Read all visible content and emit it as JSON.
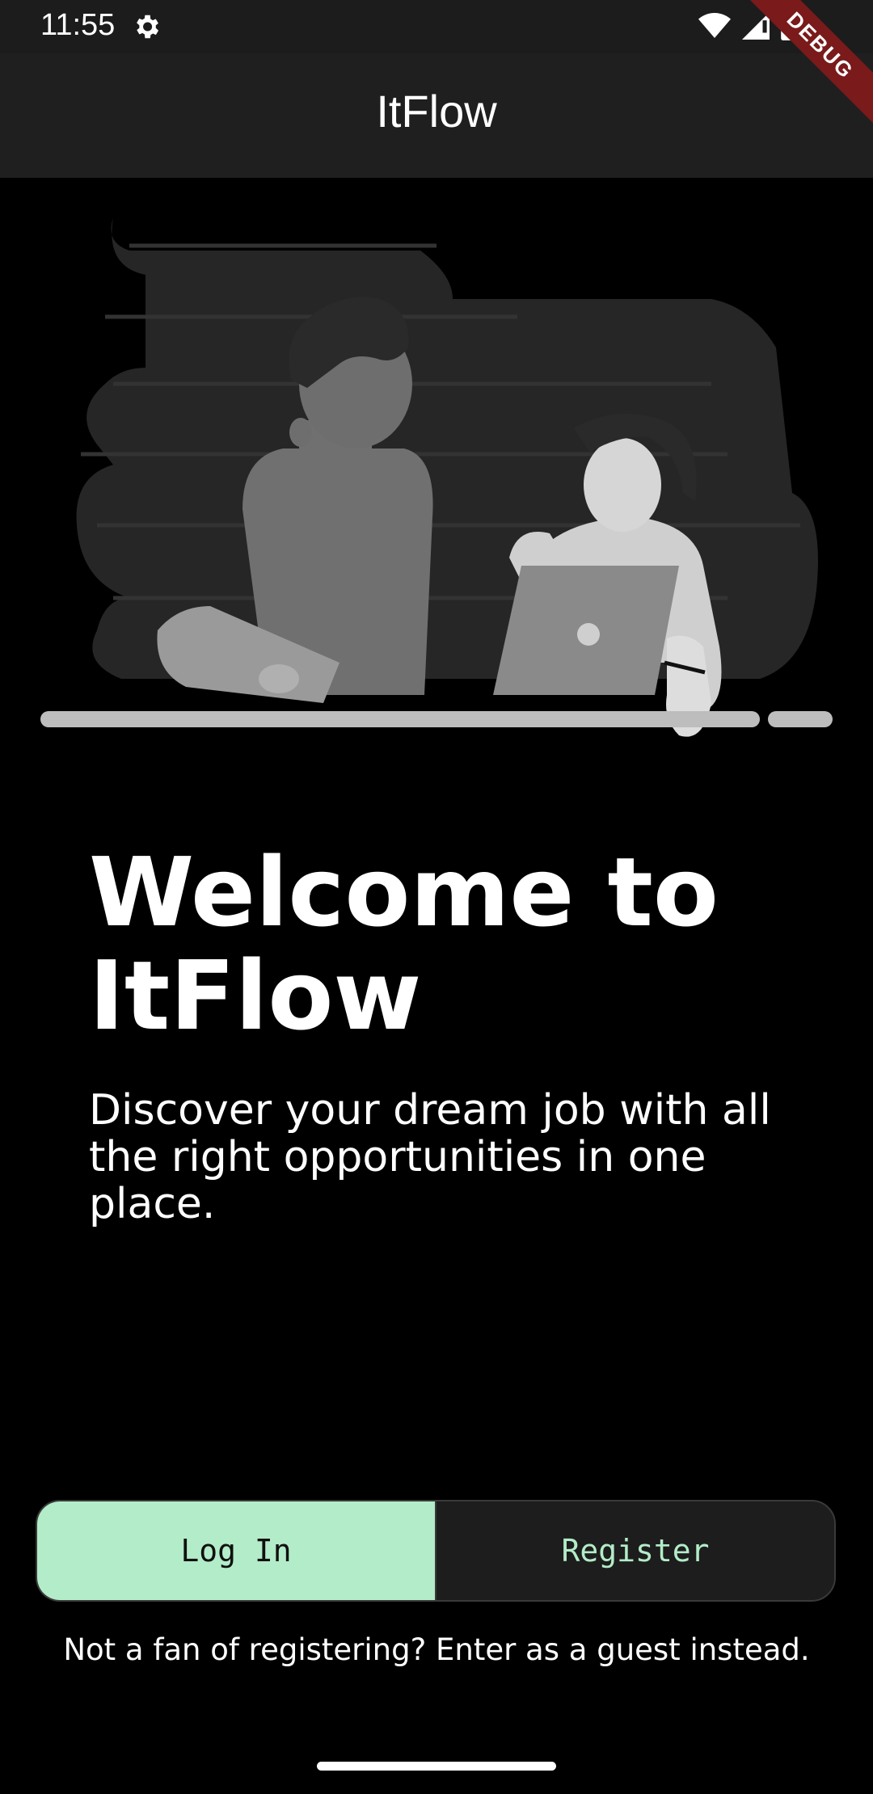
{
  "status_bar": {
    "time": "11:55",
    "icons": [
      "gear-icon",
      "wifi-icon",
      "signal-icon",
      "battery-icon"
    ]
  },
  "app_bar": {
    "title": "ItFlow",
    "debug_banner": "DEBUG"
  },
  "illustration": {
    "description_icon": "people-with-laptop-illustration"
  },
  "hero": {
    "headline_line1": "Welcome to",
    "headline_line2": "ItFlow",
    "subtitle": "Discover your dream job with all the right opportunities in one place."
  },
  "auth": {
    "login_label": "Log In",
    "register_label": "Register",
    "active": "login"
  },
  "guest": {
    "text": "Not a fan of registering? Enter as a guest instead."
  },
  "colors": {
    "accent": "#b3ecc8",
    "background": "#000000",
    "app_bar": "#1f1f1f",
    "debug_ribbon": "#7a1a1a"
  }
}
